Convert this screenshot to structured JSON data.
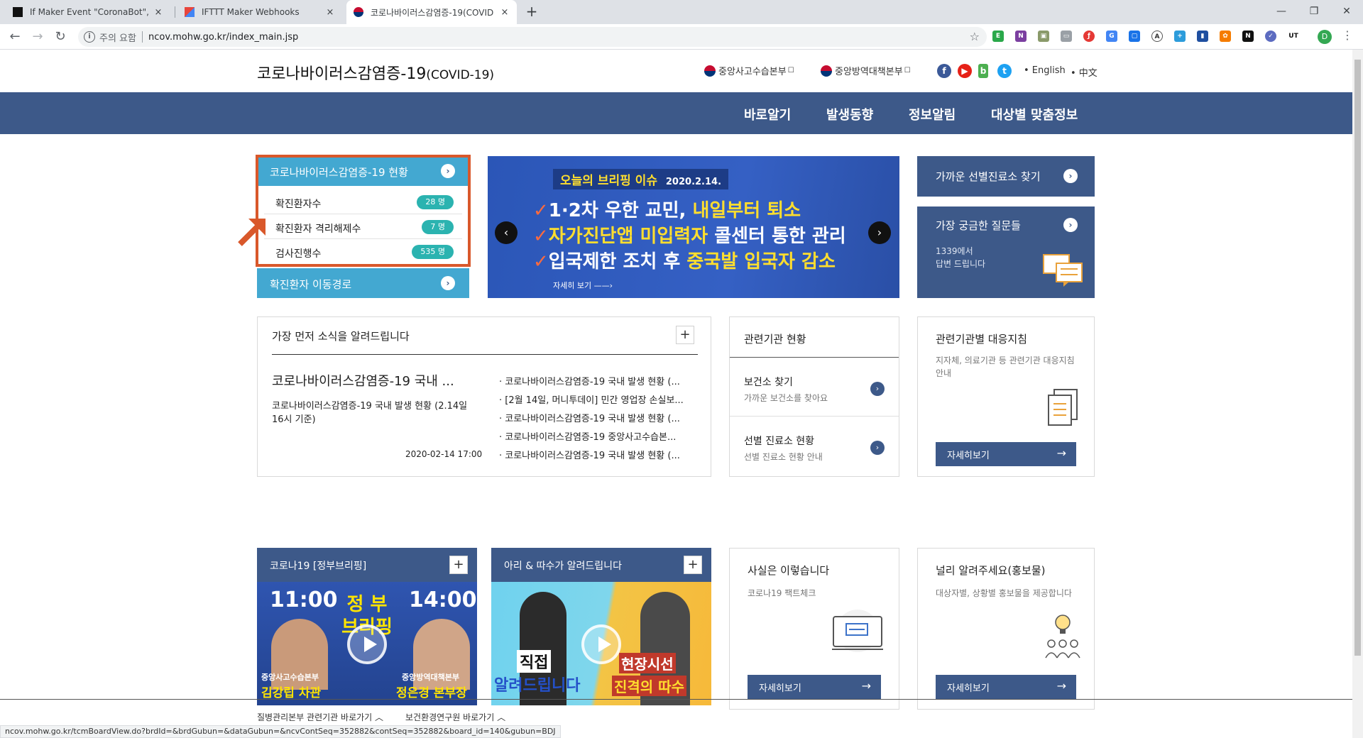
{
  "browser": {
    "tabs": [
      {
        "label": "If Maker Event \"CoronaBot\", the",
        "active": false
      },
      {
        "label": "IFTTT Maker Webhooks",
        "active": false
      },
      {
        "label": "코로나바이러스감염증-19(COVID",
        "active": true
      }
    ],
    "new_tab": "+",
    "close": "×",
    "security": "주의 요함",
    "url": "ncov.mohw.go.kr/index_main.jsp",
    "profile_initial": "D",
    "status_url": "ncov.mohw.go.kr/tcmBoardView.do?brdId=&brdGubun=&dataGubun=&ncvContSeq=352882&contSeq=352882&board_id=140&gubun=BDJ"
  },
  "header": {
    "title": "코로나바이러스감염증-19",
    "title_suffix": "(COVID-19)",
    "gov_links": [
      "중앙사고수습본부",
      "중앙방역대책본부"
    ],
    "langs": [
      "• English",
      "• 中文"
    ]
  },
  "gnb": [
    "바로알기",
    "발생동향",
    "정보알림",
    "대상별 맞춤정보"
  ],
  "status": {
    "title": "코로나바이러스감염증-19 현황",
    "rows": [
      {
        "label": "확진환자수",
        "value": "28 명"
      },
      {
        "label": "확진환자 격리해제수",
        "value": "7 명"
      },
      {
        "label": "검사진행수",
        "value": "535 명"
      }
    ],
    "route_label": "확진환자 이동경로"
  },
  "banner": {
    "tag": "오늘의 브리핑 이슈",
    "date": "2020.2.14.",
    "line1_a": "1·2차 우한 교민, ",
    "line1_b": "내일부터 퇴소",
    "line2_a": "자가진단앱 미입력자 ",
    "line2_b": "콜센터 통한 관리",
    "line3_a": "입국제한 조치 후 ",
    "line3_b": "중국발 입국자 감소",
    "more": "자세히 보기 ——›"
  },
  "right_boxes": {
    "clinic": "가까운 선별진료소 찾기",
    "faq_title": "가장 궁금한 질문들",
    "faq_sub1": "1339에서",
    "faq_sub2": "답변 드립니다"
  },
  "news": {
    "title": "가장 먼저 소식을 알려드립니다",
    "headline": "코로나바이러스감염증-19 국내 ...",
    "summary": "코로나바이러스감염증-19 국내 발생 현황 (2.14일 16시 기준)",
    "date": "2020-02-14 17:00",
    "items": [
      "· 코로나바이러스감염증-19 국내 발생 현황 (...",
      "· [2월 14일, 머니투데이] 민간 영업장 손실보...",
      "· 코로나바이러스감염증-19 국내 발생 현황 (...",
      "· 코로나바이러스감염증-19 중앙사고수습본...",
      "· 코로나바이러스감염증-19 국내 발생 현황 (..."
    ]
  },
  "agencies": {
    "title": "관련기관 현황",
    "health_center": "보건소 찾기",
    "health_center_sub": "가까운 보건소를 찾아요",
    "screening": "선별 진료소 현황",
    "screening_sub": "선별 진료소 현황 안내"
  },
  "guidelines": {
    "title": "관련기관별 대응지침",
    "desc": "지자체, 의료기관 등 관련기관 대응지침 안내",
    "button": "자세히보기"
  },
  "briefing": {
    "title": "코로나19 [정부브리핑]",
    "time1": "11:00",
    "time2": "14:00",
    "center": "정 부\n브리핑",
    "left_org": "중앙사고수습본부",
    "left_name": "김강립 차관",
    "right_org": "중앙방역대책본부",
    "right_name": "정은경 본부장"
  },
  "ari": {
    "title": "아리 & 따수가 알려드립니다",
    "left_text1": "직접",
    "left_text2": "알려드립니다",
    "right_text1": "현장시선",
    "right_text2": "진격의 따수"
  },
  "factcheck": {
    "title": "사실은 이렇습니다",
    "desc": "코로나19 팩트체크",
    "button": "자세히보기"
  },
  "promo": {
    "title": "널리 알려주세요(홍보물)",
    "desc": "대상자별, 상황별 홍보물을 제공합니다",
    "button": "자세히보기"
  },
  "footer": {
    "links": [
      "질병관리본부 관련기관 바로가기 ︿",
      "보건환경연구원 바로가기 ︿"
    ]
  },
  "colors": {
    "navy": "#3d5989",
    "cyan": "#43a8d1",
    "highlight": "#d9582b",
    "badge": "#2bb3b0"
  }
}
